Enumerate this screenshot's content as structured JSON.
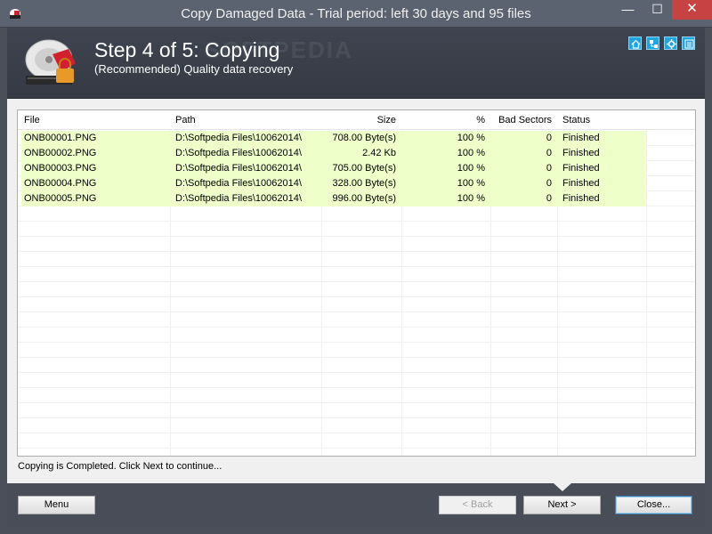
{
  "window": {
    "title": "Copy Damaged Data - Trial period: left 30 days and 95 files",
    "minimize_glyph": "—",
    "maximize_glyph": "☐",
    "close_glyph": "✕"
  },
  "header": {
    "step_title": "Step 4 of 5: Copying",
    "step_subtitle": "(Recommended) Quality data recovery",
    "watermark": "SOFTPEDIA",
    "icons": [
      "home-icon",
      "network-icon",
      "settings-icon",
      "info-icon"
    ],
    "accent_color": "#1fa6df"
  },
  "table": {
    "columns": [
      "File",
      "Path",
      "Size",
      "%",
      "Bad Sectors",
      "Status"
    ],
    "rows": [
      {
        "file": "ONB00001.PNG",
        "path": "D:\\Softpedia Files\\10062014\\",
        "size": "708.00 Byte(s)",
        "percent": "100 %",
        "bad_sectors": "0",
        "status": "Finished"
      },
      {
        "file": "ONB00002.PNG",
        "path": "D:\\Softpedia Files\\10062014\\",
        "size": "2.42 Kb",
        "percent": "100 %",
        "bad_sectors": "0",
        "status": "Finished"
      },
      {
        "file": "ONB00003.PNG",
        "path": "D:\\Softpedia Files\\10062014\\",
        "size": "705.00 Byte(s)",
        "percent": "100 %",
        "bad_sectors": "0",
        "status": "Finished"
      },
      {
        "file": "ONB00004.PNG",
        "path": "D:\\Softpedia Files\\10062014\\",
        "size": "328.00 Byte(s)",
        "percent": "100 %",
        "bad_sectors": "0",
        "status": "Finished"
      },
      {
        "file": "ONB00005.PNG",
        "path": "D:\\Softpedia Files\\10062014\\",
        "size": "996.00 Byte(s)",
        "percent": "100 %",
        "bad_sectors": "0",
        "status": "Finished"
      }
    ],
    "row_highlight_color": "#efffc9"
  },
  "status_text": "Copying is Completed. Click Next to continue...",
  "buttons": {
    "menu": "Menu",
    "back": "< Back",
    "next": "Next >",
    "close": "Close..."
  }
}
